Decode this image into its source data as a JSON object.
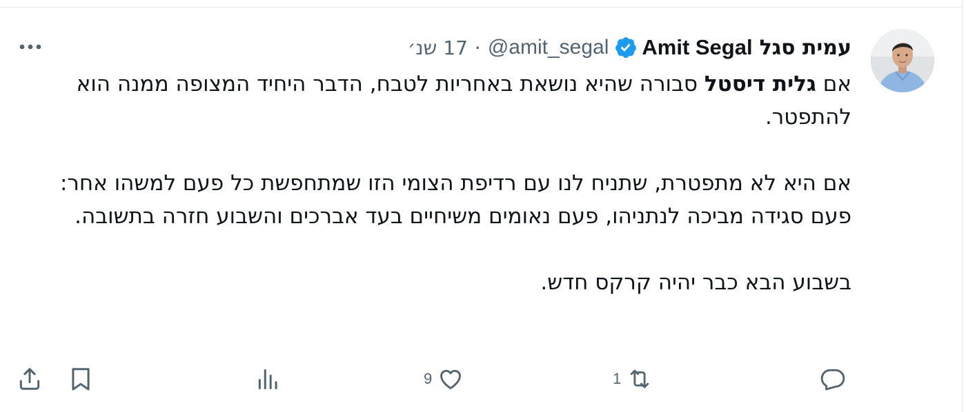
{
  "tweet": {
    "author": {
      "name_he": "עמית סגל",
      "name_en": "Amit Segal",
      "handle": "@amit_segal",
      "verified": true
    },
    "separator": "·",
    "time": "17 שנ׳",
    "body": {
      "p1_prefix": "אם ",
      "p1_bold": "גלית דיסטל",
      "p1_suffix": " סבורה שהיא נושאת באחריות לטבח, הדבר היחיד המצופה ממנה הוא להתפטר.",
      "p2": "אם היא לא מתפטרת, שתניח לנו עם רדיפת הצומי הזו שמתחפשת כל פעם למשהו אחר: פעם סגידה מביכה לנתניהו, פעם נאומים משיחיים בעד אברכים והשבוע חזרה בתשובה.",
      "p3": "בשבוע הבא כבר יהיה קרקס חדש."
    }
  },
  "actions": {
    "reply": {
      "icon": "reply-icon"
    },
    "retweet": {
      "icon": "retweet-icon",
      "count": "1"
    },
    "like": {
      "icon": "heart-icon",
      "count": "9"
    },
    "views": {
      "icon": "views-icon"
    },
    "bookmark": {
      "icon": "bookmark-icon"
    },
    "share": {
      "icon": "share-icon"
    }
  },
  "colors": {
    "text": "#0f1419",
    "secondary": "#536471",
    "verified": "#1d9bf0"
  }
}
